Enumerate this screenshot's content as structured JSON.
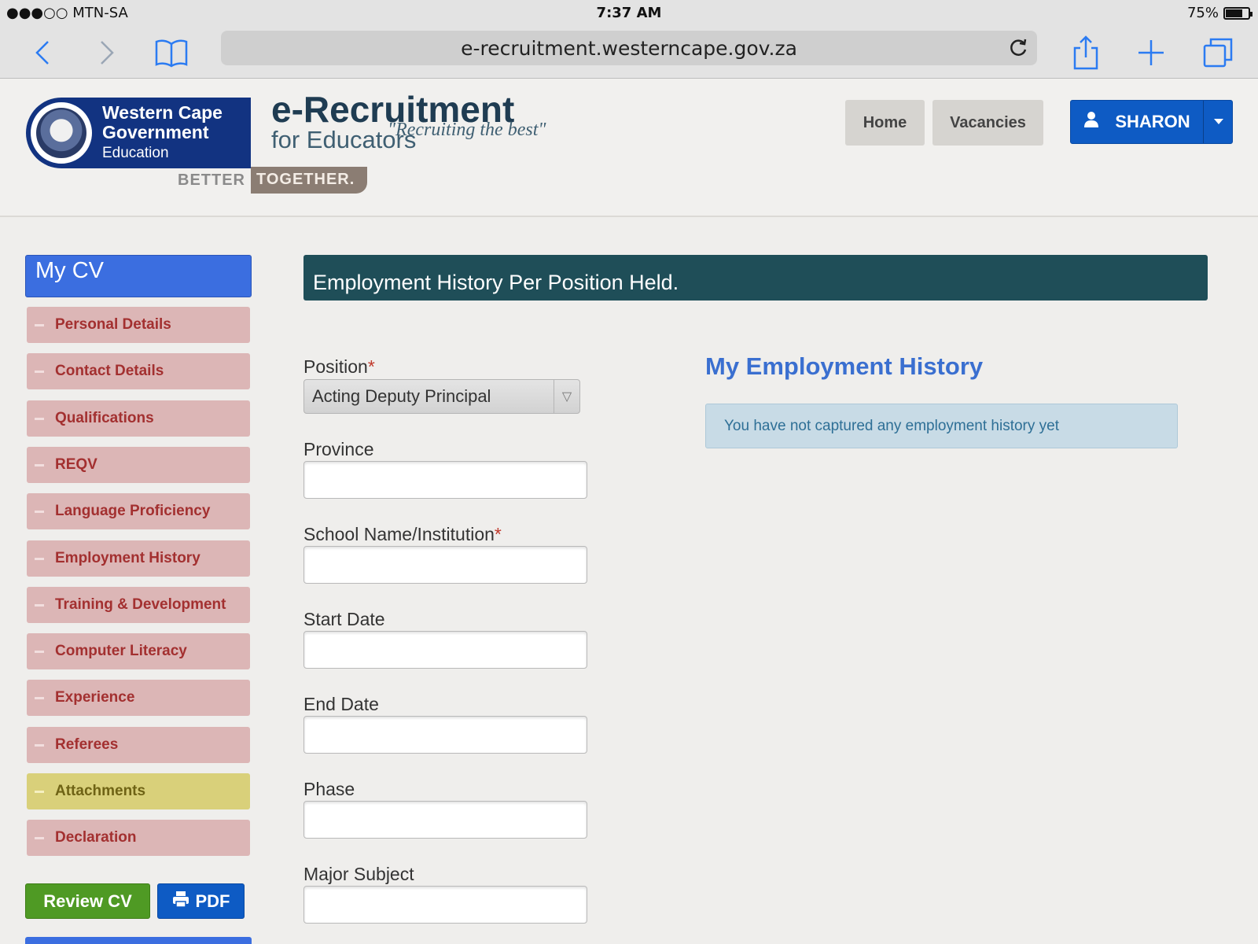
{
  "status_bar": {
    "carrier": "●●●○○ MTN-SA",
    "time": "7:37 AM",
    "battery": "75%",
    "battery_level": 0.75
  },
  "browser": {
    "url": "e-recruitment.westerncape.gov.za"
  },
  "header": {
    "logo": {
      "line1": "Western Cape",
      "line2": "Government",
      "line3": "Education",
      "better": "BETTER",
      "together": "TOGETHER."
    },
    "title": "e-Recruitment",
    "subtitle": "for Educators",
    "tagline": "\"Recruiting the best\"",
    "nav": [
      {
        "label": "Home"
      },
      {
        "label": "Vacancies"
      }
    ],
    "user": {
      "name": "SHARON"
    }
  },
  "sidebar": {
    "title": "My CV",
    "items": [
      {
        "label": "Personal Details",
        "active": false
      },
      {
        "label": "Contact Details",
        "active": false
      },
      {
        "label": "Qualifications",
        "active": false
      },
      {
        "label": "REQV",
        "active": false
      },
      {
        "label": "Language Proficiency",
        "active": false
      },
      {
        "label": "Employment History",
        "active": false
      },
      {
        "label": "Training & Development",
        "active": false
      },
      {
        "label": "Computer Literacy",
        "active": false
      },
      {
        "label": "Experience",
        "active": false
      },
      {
        "label": "Referees",
        "active": false
      },
      {
        "label": "Attachments",
        "active": true
      },
      {
        "label": "Declaration",
        "active": false
      }
    ],
    "review_button": "Review CV",
    "pdf_button": "PDF"
  },
  "main": {
    "section_title": "Employment History Per Position Held.",
    "form": {
      "position": {
        "label": "Position",
        "required": "*",
        "value": "Acting Deputy Principal"
      },
      "province": {
        "label": "Province",
        "value": ""
      },
      "school": {
        "label": "School Name/Institution",
        "required": "*",
        "value": ""
      },
      "start_date": {
        "label": "Start Date",
        "value": ""
      },
      "end_date": {
        "label": "End Date",
        "value": ""
      },
      "phase": {
        "label": "Phase",
        "value": ""
      },
      "major_subject": {
        "label": "Major Subject",
        "value": ""
      }
    },
    "history": {
      "title": "My Employment History",
      "empty_message": "You have not captured any employment history yet"
    }
  }
}
